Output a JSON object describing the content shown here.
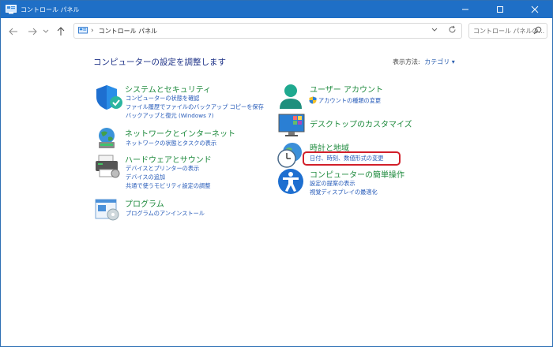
{
  "window": {
    "title": "コントロール パネル",
    "controls": {
      "minimize": "—",
      "maximize": "☐",
      "close": "✕"
    }
  },
  "nav": {
    "breadcrumb_sep": "›",
    "breadcrumb": "コントロール パネル",
    "search_placeholder": "コントロール パネルの..."
  },
  "content": {
    "heading": "コンピューターの設定を調整します",
    "view_by_label": "表示方法:",
    "view_by_value": "カテゴリ ▾"
  },
  "categories_left": [
    {
      "title": "システムとセキュリティ",
      "links": [
        "コンピューターの状態を確認",
        "ファイル履歴でファイルのバックアップ コピーを保存",
        "バックアップと復元 (Windows 7)"
      ]
    },
    {
      "title": "ネットワークとインターネット",
      "links": [
        "ネットワークの状態とタスクの表示"
      ]
    },
    {
      "title": "ハードウェアとサウンド",
      "links": [
        "デバイスとプリンターの表示",
        "デバイスの追加",
        "共通で使うモビリティ設定の調整"
      ]
    },
    {
      "title": "プログラム",
      "links": [
        "プログラムのアンインストール"
      ]
    }
  ],
  "categories_right": [
    {
      "title": "ユーザー アカウント",
      "links": [
        "アカウントの種類の変更"
      ]
    },
    {
      "title": "デスクトップのカスタマイズ",
      "links": []
    },
    {
      "title": "時計と地域",
      "links": [
        "日付、時刻、数値形式の変更"
      ]
    },
    {
      "title": "コンピューターの簡単操作",
      "links": [
        "設定の提案の表示",
        "視覚ディスプレイの最適化"
      ]
    }
  ],
  "colors": {
    "titlebar": "#1f6fc6",
    "category_title": "#1e8a3d",
    "link": "#2459b8",
    "highlight": "#d21f2a"
  }
}
